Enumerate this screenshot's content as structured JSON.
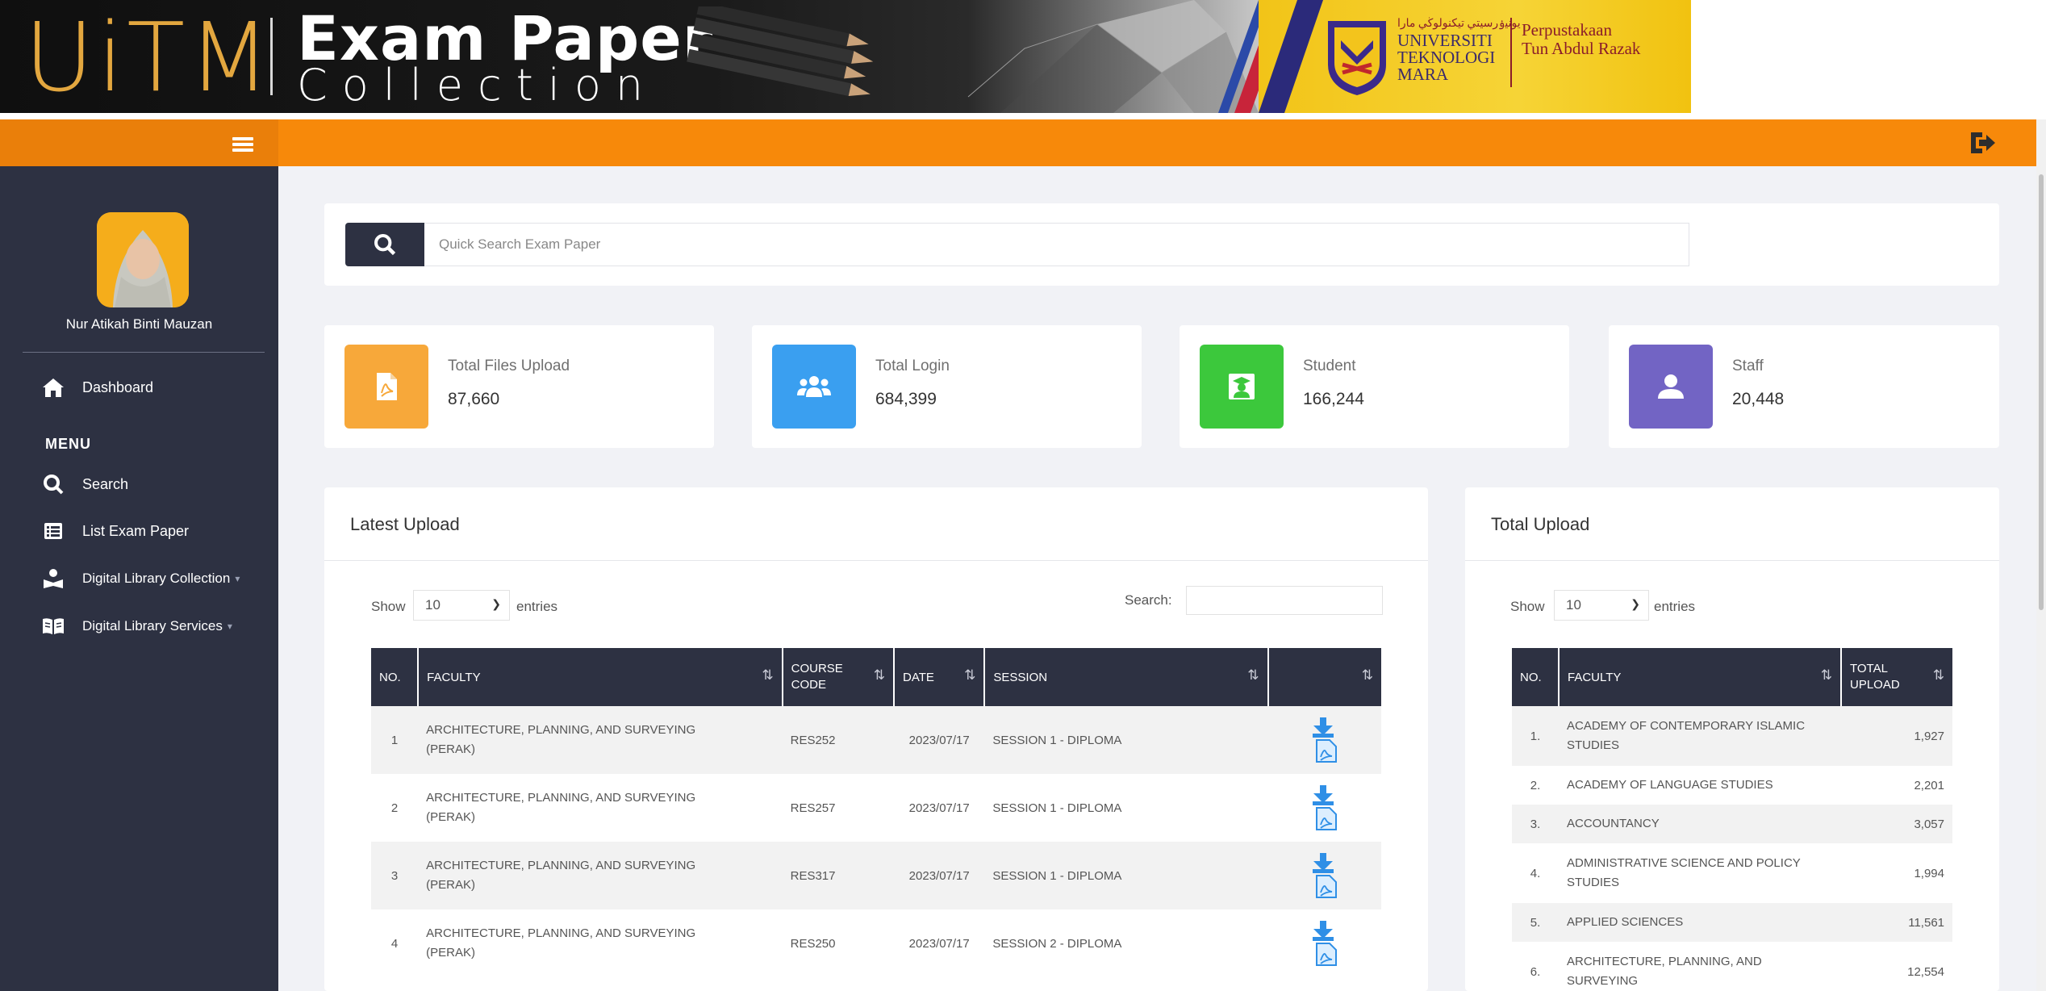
{
  "banner": {
    "logo_text": "UiTM",
    "title_line1": "Exam Paper",
    "title_line2": "Collection",
    "university_jawi": "ﻳﻮﻧﻴۏرسيتي تيكنولوڬي مارا",
    "university_lines": [
      "UNIVERSITI",
      "TEKNOLOGI",
      "MARA"
    ],
    "library_lines": [
      "Perpustakaan",
      "Tun Abdul Razak"
    ]
  },
  "topbar": {
    "menu_icon": "hamburger-icon",
    "logout_icon": "logout-icon"
  },
  "sidebar": {
    "user_name": "Nur Atikah Binti Mauzan",
    "dashboard_label": "Dashboard",
    "menu_heading": "MENU",
    "items": [
      {
        "label": "Search",
        "icon": "search-icon"
      },
      {
        "label": "List Exam Paper",
        "icon": "list-icon"
      },
      {
        "label": "Digital Library Collection",
        "icon": "reader-icon",
        "has_caret": true
      },
      {
        "label": "Digital Library Services",
        "icon": "book-open-icon",
        "has_caret": true
      }
    ]
  },
  "search": {
    "placeholder": "Quick Search Exam Paper"
  },
  "stats": [
    {
      "label": "Total Files Upload",
      "value": "87,660",
      "color": "#f7a83a",
      "icon": "pdf-file-icon"
    },
    {
      "label": "Total Login",
      "value": "684,399",
      "color": "#3a9ff0",
      "icon": "users-icon"
    },
    {
      "label": "Student",
      "value": "166,244",
      "color": "#3cc83c",
      "icon": "graduate-icon"
    },
    {
      "label": "Staff",
      "value": "20,448",
      "color": "#7264c4",
      "icon": "user-icon"
    }
  ],
  "latest_upload": {
    "title": "Latest Upload",
    "show_label": "Show",
    "entries_value": "10",
    "entries_label": "entries",
    "search_label": "Search:",
    "columns": [
      "NO.",
      "FACULTY",
      "COURSE CODE",
      "DATE",
      "SESSION",
      ""
    ],
    "course_code_lines": [
      "COURSE",
      "CODE"
    ],
    "rows": [
      {
        "no": "1",
        "faculty_line1": "ARCHITECTURE, PLANNING, AND SURVEYING",
        "faculty_line2": "(PERAK)",
        "course_code": "RES252",
        "date": "2023/07/17",
        "session": "SESSION 1 - DIPLOMA"
      },
      {
        "no": "2",
        "faculty_line1": "ARCHITECTURE, PLANNING, AND SURVEYING",
        "faculty_line2": "(PERAK)",
        "course_code": "RES257",
        "date": "2023/07/17",
        "session": "SESSION 1 - DIPLOMA"
      },
      {
        "no": "3",
        "faculty_line1": "ARCHITECTURE, PLANNING, AND SURVEYING",
        "faculty_line2": "(PERAK)",
        "course_code": "RES317",
        "date": "2023/07/17",
        "session": "SESSION 1 - DIPLOMA"
      },
      {
        "no": "4",
        "faculty_line1": "ARCHITECTURE, PLANNING, AND SURVEYING",
        "faculty_line2": "(PERAK)",
        "course_code": "RES250",
        "date": "2023/07/17",
        "session": "SESSION 2 - DIPLOMA"
      }
    ]
  },
  "total_upload": {
    "title": "Total Upload",
    "show_label": "Show",
    "entries_value": "10",
    "entries_label": "entries",
    "columns": [
      "NO.",
      "FACULTY",
      "TOTAL UPLOAD"
    ],
    "total_upload_lines": [
      "TOTAL",
      "UPLOAD"
    ],
    "rows": [
      {
        "no": "1.",
        "faculty_line1": "ACADEMY OF CONTEMPORARY ISLAMIC",
        "faculty_line2": "STUDIES",
        "total": "1,927"
      },
      {
        "no": "2.",
        "faculty_line1": "ACADEMY OF LANGUAGE STUDIES",
        "faculty_line2": "",
        "total": "2,201"
      },
      {
        "no": "3.",
        "faculty_line1": "ACCOUNTANCY",
        "faculty_line2": "",
        "total": "3,057"
      },
      {
        "no": "4.",
        "faculty_line1": "ADMINISTRATIVE SCIENCE AND POLICY",
        "faculty_line2": "STUDIES",
        "total": "1,994"
      },
      {
        "no": "5.",
        "faculty_line1": "APPLIED SCIENCES",
        "faculty_line2": "",
        "total": "11,561"
      },
      {
        "no": "6.",
        "faculty_line1": "ARCHITECTURE, PLANNING, AND",
        "faculty_line2": "SURVEYING",
        "total": "12,554"
      }
    ]
  },
  "colors": {
    "brand_orange": "#f7890a",
    "sidebar_bg": "#2d3142",
    "download_blue": "#2f8fe6"
  }
}
